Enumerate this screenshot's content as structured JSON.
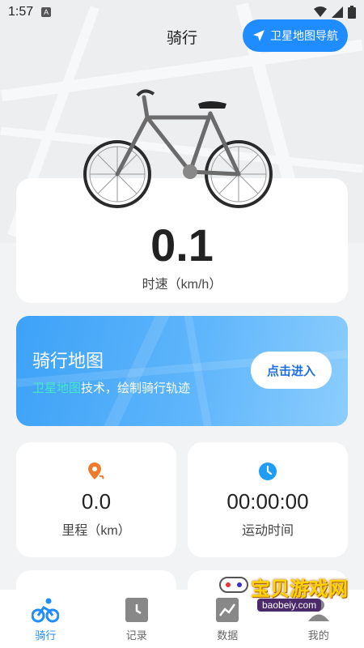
{
  "status_bar": {
    "time": "1:57",
    "notif_icon": "a-icon",
    "icons": [
      "wifi-icon",
      "signal-icon",
      "battery-icon"
    ]
  },
  "header": {
    "title": "骑行",
    "nav_button_label": "卫星地图导航"
  },
  "speed": {
    "value": "0.1",
    "unit_label": "时速（km/h）"
  },
  "map_card": {
    "title": "骑行地图",
    "subtitle_highlight": "卫星地图",
    "subtitle_rest": "技术，绘制骑行轨迹",
    "button_label": "点击进入"
  },
  "stats": [
    {
      "value": "0.0",
      "label": "里程（km）",
      "icon": "location-pin-icon"
    },
    {
      "value": "00:00:00",
      "label": "运动时间",
      "icon": "clock-icon"
    }
  ],
  "tabs": [
    {
      "label": "骑行",
      "icon": "bike-icon",
      "active": true
    },
    {
      "label": "记录",
      "icon": "clock-doc-icon",
      "active": false
    },
    {
      "label": "数据",
      "icon": "chart-icon",
      "active": false
    },
    {
      "label": "我的",
      "icon": "user-icon",
      "active": false
    }
  ],
  "watermark": {
    "text": "宝贝游戏网",
    "url": "baobeiy.com"
  },
  "colors": {
    "accent": "#1f8cff",
    "card_gradient_start": "#3da2f7",
    "highlight": "#46e7c8",
    "orange": "#f07a2a"
  }
}
